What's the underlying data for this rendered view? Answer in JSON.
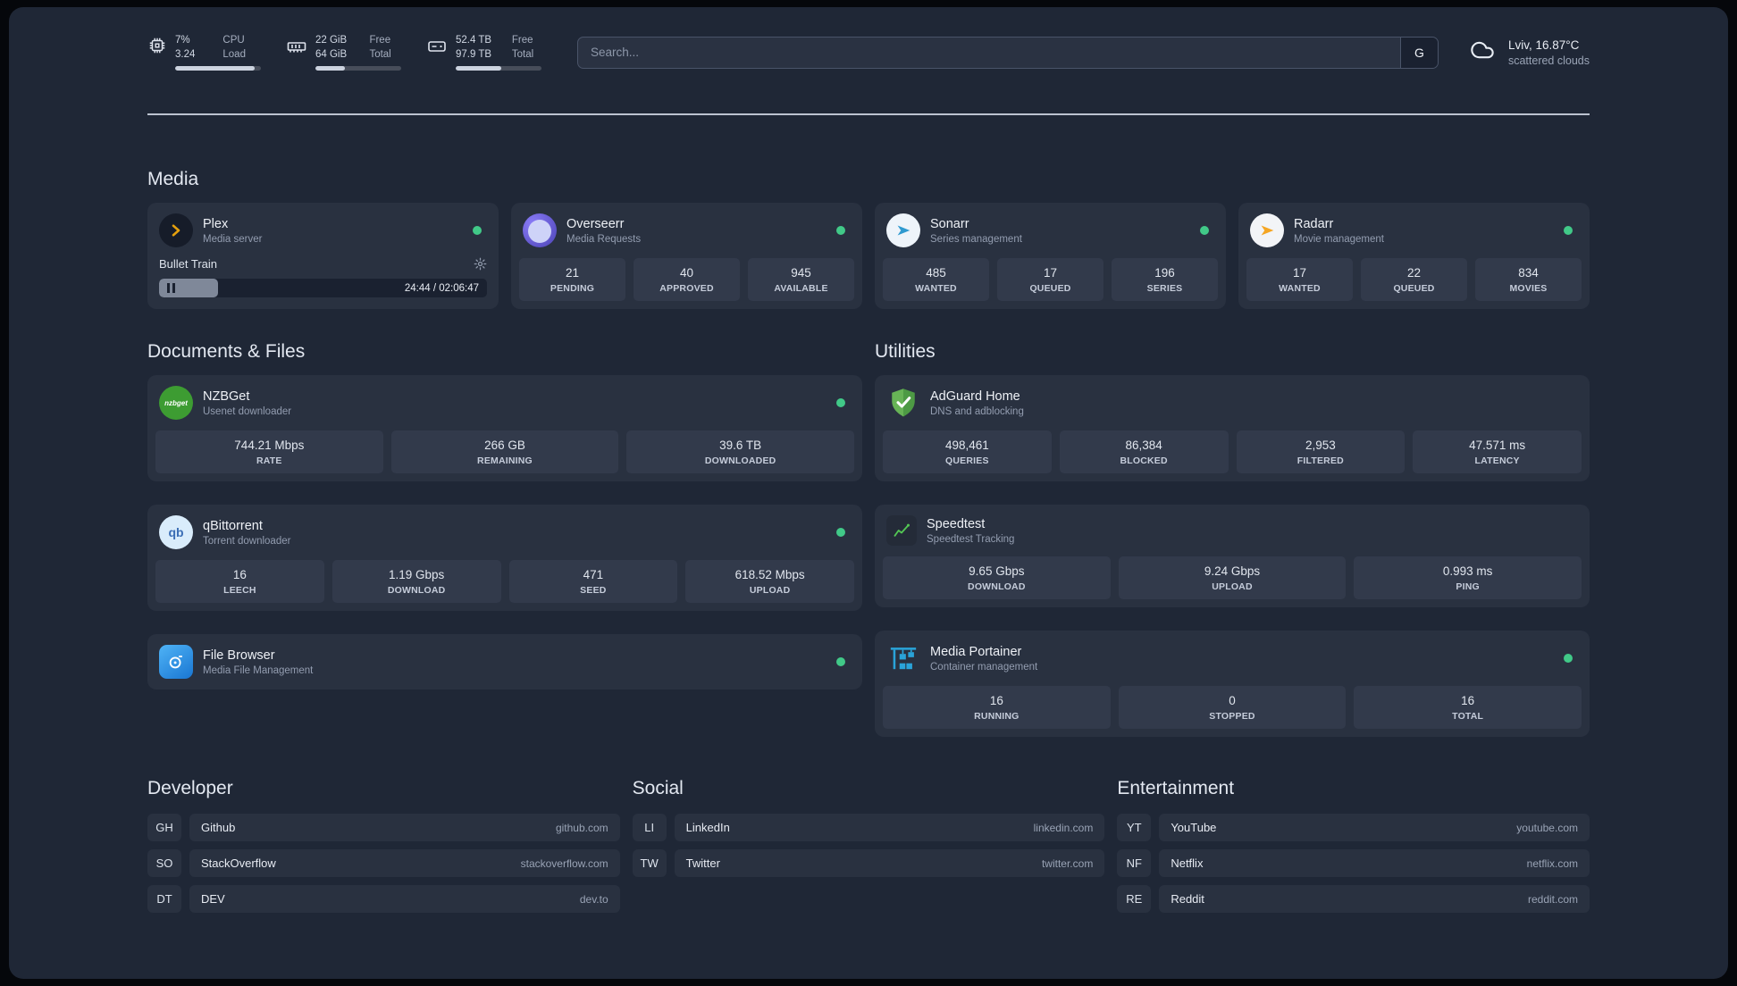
{
  "topbar": {
    "resources": [
      {
        "icon": "cpu-icon",
        "rows": [
          {
            "value": "7%",
            "label": "CPU"
          },
          {
            "value": "3.24",
            "label": "Load"
          }
        ],
        "bar_pct": 93
      },
      {
        "icon": "ram-icon",
        "rows": [
          {
            "value": "22 GiB",
            "label": "Free"
          },
          {
            "value": "64 GiB",
            "label": "Total"
          }
        ],
        "bar_pct": 34
      },
      {
        "icon": "disk-icon",
        "rows": [
          {
            "value": "52.4 TB",
            "label": "Free"
          },
          {
            "value": "97.9 TB",
            "label": "Total"
          }
        ],
        "bar_pct": 53
      }
    ],
    "search": {
      "placeholder": "Search...",
      "provider_label": "G"
    },
    "weather": {
      "icon": "cloud-icon",
      "location": "Lviv, 16.87°C",
      "condition": "scattered clouds"
    }
  },
  "sections": {
    "media": {
      "title": "Media",
      "cards": [
        {
          "icon": "plex-icon",
          "name": "Plex",
          "desc": "Media server",
          "status": "online",
          "player": {
            "track_title": "Bullet Train",
            "time": "24:44 / 02:06:47",
            "progress_pct": 18
          }
        },
        {
          "icon": "overseerr-icon",
          "name": "Overseerr",
          "desc": "Media Requests",
          "status": "online",
          "stats": [
            {
              "value": "21",
              "label": "PENDING"
            },
            {
              "value": "40",
              "label": "APPROVED"
            },
            {
              "value": "945",
              "label": "AVAILABLE"
            }
          ]
        },
        {
          "icon": "sonarr-icon",
          "name": "Sonarr",
          "desc": "Series management",
          "status": "online",
          "stats": [
            {
              "value": "485",
              "label": "WANTED"
            },
            {
              "value": "17",
              "label": "QUEUED"
            },
            {
              "value": "196",
              "label": "SERIES"
            }
          ]
        },
        {
          "icon": "radarr-icon",
          "name": "Radarr",
          "desc": "Movie management",
          "status": "online",
          "stats": [
            {
              "value": "17",
              "label": "WANTED"
            },
            {
              "value": "22",
              "label": "QUEUED"
            },
            {
              "value": "834",
              "label": "MOVIES"
            }
          ]
        }
      ]
    },
    "documents": {
      "title": "Documents & Files",
      "cards": [
        {
          "icon": "nzbget-icon",
          "icon_text": "nzbget",
          "name": "NZBGet",
          "desc": "Usenet downloader",
          "status": "online",
          "stats": [
            {
              "value": "744.21 Mbps",
              "label": "RATE"
            },
            {
              "value": "266 GB",
              "label": "REMAINING"
            },
            {
              "value": "39.6 TB",
              "label": "DOWNLOADED"
            }
          ]
        },
        {
          "icon": "qbittorrent-icon",
          "icon_text": "qb",
          "name": "qBittorrent",
          "desc": "Torrent downloader",
          "status": "online",
          "stats": [
            {
              "value": "16",
              "label": "LEECH"
            },
            {
              "value": "1.19 Gbps",
              "label": "DOWNLOAD"
            },
            {
              "value": "471",
              "label": "SEED"
            },
            {
              "value": "618.52 Mbps",
              "label": "UPLOAD"
            }
          ]
        },
        {
          "icon": "filebrowser-icon",
          "name": "File Browser",
          "desc": "Media File Management",
          "status": "online"
        }
      ]
    },
    "utilities": {
      "title": "Utilities",
      "cards": [
        {
          "icon": "adguard-icon",
          "name": "AdGuard Home",
          "desc": "DNS and adblocking",
          "stats": [
            {
              "value": "498,461",
              "label": "QUERIES"
            },
            {
              "value": "86,384",
              "label": "BLOCKED"
            },
            {
              "value": "2,953",
              "label": "FILTERED"
            },
            {
              "value": "47.571 ms",
              "label": "LATENCY"
            }
          ]
        },
        {
          "icon": "speedtest-icon",
          "name": "Speedtest",
          "desc": "Speedtest Tracking",
          "stats": [
            {
              "value": "9.65 Gbps",
              "label": "DOWNLOAD"
            },
            {
              "value": "9.24 Gbps",
              "label": "UPLOAD"
            },
            {
              "value": "0.993 ms",
              "label": "PING"
            }
          ]
        },
        {
          "icon": "portainer-icon",
          "name": "Media Portainer",
          "desc": "Container management",
          "status": "online",
          "stats": [
            {
              "value": "16",
              "label": "RUNNING"
            },
            {
              "value": "0",
              "label": "STOPPED"
            },
            {
              "value": "16",
              "label": "TOTAL"
            }
          ]
        }
      ]
    }
  },
  "bookmarks": [
    {
      "title": "Developer",
      "items": [
        {
          "abbr": "GH",
          "name": "Github",
          "url": "github.com"
        },
        {
          "abbr": "SO",
          "name": "StackOverflow",
          "url": "stackoverflow.com"
        },
        {
          "abbr": "DT",
          "name": "DEV",
          "url": "dev.to"
        }
      ]
    },
    {
      "title": "Social",
      "items": [
        {
          "abbr": "LI",
          "name": "LinkedIn",
          "url": "linkedin.com"
        },
        {
          "abbr": "TW",
          "name": "Twitter",
          "url": "twitter.com"
        }
      ]
    },
    {
      "title": "Entertainment",
      "items": [
        {
          "abbr": "YT",
          "name": "YouTube",
          "url": "youtube.com"
        },
        {
          "abbr": "NF",
          "name": "Netflix",
          "url": "netflix.com"
        },
        {
          "abbr": "RE",
          "name": "Reddit",
          "url": "reddit.com"
        }
      ]
    }
  ],
  "colors": {
    "background": "#1f2736",
    "card": "#293140",
    "tile": "#323a4b",
    "status_online": "#41c988",
    "plex_accent": "#e5a00d",
    "divider": "#d8dfeb"
  }
}
